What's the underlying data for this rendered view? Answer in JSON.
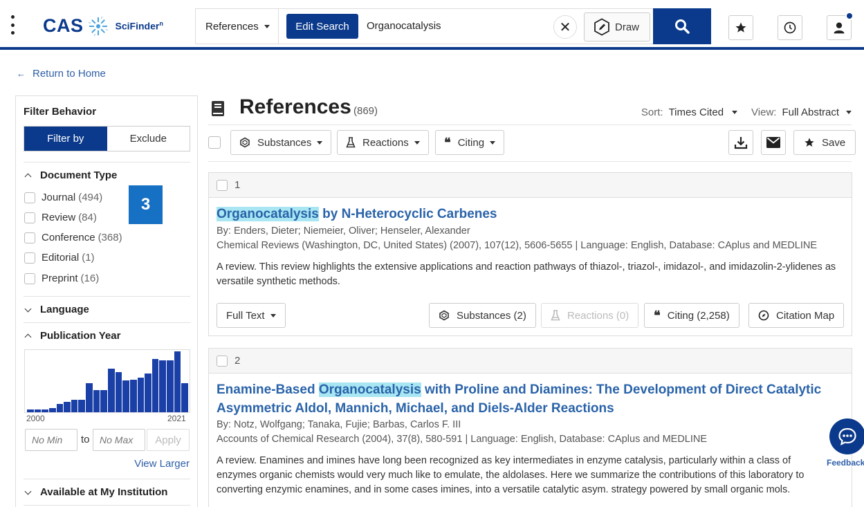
{
  "header": {
    "logo_text": "CAS",
    "product_name": "SciFinder",
    "product_sup": "n",
    "search_scope": "References",
    "edit_search_label": "Edit Search",
    "search_query": "Organocatalysis",
    "clear_symbol": "✕",
    "draw_label": "Draw",
    "brand_color": "#0b3a8c"
  },
  "return_link": "Return to Home",
  "sidebar": {
    "filter_behavior_title": "Filter Behavior",
    "filter_by_label": "Filter by",
    "exclude_label": "Exclude",
    "document_type": {
      "title": "Document Type",
      "items": [
        {
          "label": "Journal",
          "count": "(494)"
        },
        {
          "label": "Review",
          "count": "(84)"
        },
        {
          "label": "Conference",
          "count": "(368)"
        },
        {
          "label": "Editorial",
          "count": "(1)"
        },
        {
          "label": "Preprint",
          "count": "(16)"
        }
      ]
    },
    "callout_number": "3",
    "language_title": "Language",
    "publication_year": {
      "title": "Publication Year",
      "start_label": "2000",
      "end_label": "2021",
      "bar_levels": [
        0.04,
        0.05,
        0.05,
        0.07,
        0.14,
        0.17,
        0.21,
        0.21,
        0.48,
        0.36,
        0.36,
        0.72,
        0.66,
        0.52,
        0.53,
        0.57,
        0.64,
        0.87,
        0.85,
        0.85,
        1.0,
        0.48
      ],
      "min_placeholder": "No Min",
      "to_label": "to",
      "max_placeholder": "No Max",
      "apply_label": "Apply",
      "view_larger_label": "View Larger"
    },
    "available_title": "Available at My Institution"
  },
  "main": {
    "title": "References",
    "count": "(869)",
    "sort_label": "Sort:",
    "sort_value": "Times Cited",
    "view_label": "View:",
    "view_value": "Full Abstract",
    "toolbar": {
      "substances_label": "Substances",
      "reactions_label": "Reactions",
      "citing_label": "Citing",
      "save_label": "Save"
    },
    "results": [
      {
        "number": "1",
        "title_hl": "Organocatalysis",
        "title_rest": " by N-Heterocyclic Carbenes",
        "authors": "By: Enders, Dieter; Niemeier, Oliver; Henseler, Alexander",
        "source": "Chemical Reviews (Washington, DC, United States) (2007), 107(12), 5606-5655 | Language: English, Database: CAplus and MEDLINE",
        "abstract": "A review. This review highlights the extensive applications and reaction pathways of thiazol-, triazol-, imidazol-, and imidazolin-2-ylidenes as versatile synthetic methods.",
        "full_text_label": "Full Text",
        "substances_label": "Substances (2)",
        "reactions_label": "Reactions (0)",
        "citing_label": "Citing (2,258)",
        "citation_map_label": "Citation Map"
      },
      {
        "number": "2",
        "title_pre": "Enamine-Based ",
        "title_hl": "Organocatalysis",
        "title_rest": " with Proline and Diamines: The Development of Direct Catalytic Asymmetric Aldol, Mannich, Michael, and Diels-Alder Reactions",
        "authors": "By: Notz, Wolfgang; Tanaka, Fujie; Barbas, Carlos F. III",
        "source": "Accounts of Chemical Research (2004), 37(8), 580-591 | Language: English, Database: CAplus and MEDLINE",
        "abstract": "A review. Enamines and imines have long been recognized as key intermediates in enzyme catalysis, particularly within a class of enzymes organic chemists would very much like to emulate, the aldolases. Here we summarize the contributions of this laboratory to converting enzymic enamines, and in some cases imines, into a versatile catalytic asym. strategy powered by small organic mols."
      }
    ]
  },
  "feedback_label": "Feedback"
}
